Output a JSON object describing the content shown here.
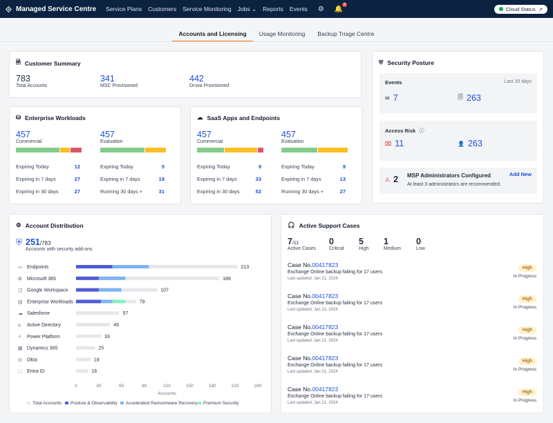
{
  "app": {
    "title": "Managed Service Centre"
  },
  "nav": [
    "Service Plans",
    "Customers",
    "Service Monitoring",
    "Jobs",
    "Reports",
    "Events"
  ],
  "notification_count": "8",
  "cloud_status": "Cloud Status",
  "tabs": [
    "Accounts and Licensing",
    "Usage Monitoring",
    "Backup Triage Centre"
  ],
  "customer_summary": {
    "title": "Customer Summary",
    "total": {
      "value": "783",
      "label": "Total Accounts"
    },
    "msc": {
      "value": "341",
      "label": "MSC Provisioned"
    },
    "druva": {
      "value": "442",
      "label": "Druva Provisioned"
    }
  },
  "security": {
    "title": "Security Posture",
    "events_label": "Events",
    "period": "Last 30 days",
    "events": [
      "7",
      "263"
    ],
    "risk_label": "Access Risk",
    "risk": [
      "11",
      "263"
    ],
    "admins": {
      "count": "2",
      "title": "MSP Administrators Configured",
      "note": "At least 3 administrators are recommended.",
      "action": "Add New"
    }
  },
  "enterprise": {
    "title": "Enterprise Workloads",
    "commercial": {
      "value": "457",
      "label": "Commercial",
      "rows": [
        [
          "Expiring Today",
          "12"
        ],
        [
          "Expiring in 7 days",
          "27"
        ],
        [
          "Expiring in 30 days",
          "27"
        ]
      ]
    },
    "evaluation": {
      "value": "457",
      "label": "Evaluation",
      "rows": [
        [
          "Expiring Today",
          "5"
        ],
        [
          "Expiring in 7 days",
          "19"
        ],
        [
          "Running 30 days +",
          "31"
        ]
      ]
    }
  },
  "saas": {
    "title": "SaaS Apps and Endpoints",
    "commercial": {
      "value": "457",
      "label": "Commercial",
      "rows": [
        [
          "Expiring Today",
          "9"
        ],
        [
          "Expiring in 7 days",
          "33"
        ],
        [
          "Expiring in 30 days",
          "52"
        ]
      ]
    },
    "evaluation": {
      "value": "457",
      "label": "Evaluation",
      "rows": [
        [
          "Expiring Today",
          "9"
        ],
        [
          "Expiring in 7 days",
          "13"
        ],
        [
          "Running 30 days +",
          "27"
        ]
      ]
    }
  },
  "distribution": {
    "title": "Account Distribution",
    "count": "251",
    "total": "/783",
    "subtitle": "Accounts with security add-ons",
    "xlabel": "Accounts",
    "legend": [
      "Total Accounts",
      "Posture & Observability",
      "Accelerated Ransomware Recovery",
      "Premium Security"
    ]
  },
  "chart_data": {
    "type": "bar",
    "orientation": "horizontal",
    "categories": [
      "Endpoints",
      "Microsoft 365",
      "Google Workspace",
      "Enterprise Workloads",
      "Salesforce",
      "Active Directory",
      "Power Platform",
      "Dynamics 365",
      "Okta",
      "Entra ID"
    ],
    "series": [
      {
        "name": "Total Accounts",
        "values": [
          213,
          189,
          107,
          79,
          57,
          45,
          33,
          25,
          19,
          16
        ]
      },
      {
        "name": "Posture & Observability",
        "values": [
          48,
          30,
          30,
          33,
          0,
          0,
          0,
          0,
          0,
          0
        ]
      },
      {
        "name": "Accelerated Ransomware Recovery",
        "values": [
          48,
          35,
          30,
          15,
          0,
          0,
          0,
          0,
          0,
          0
        ]
      },
      {
        "name": "Premium Security",
        "values": [
          0,
          0,
          0,
          17,
          0,
          0,
          0,
          0,
          0,
          0
        ]
      }
    ],
    "xlim": [
      0,
      240
    ],
    "xticks": [
      "0",
      "30",
      "60",
      "90",
      "120",
      "150",
      "180",
      "210",
      "240"
    ],
    "xlabel": "Accounts",
    "legend_position": "bottom",
    "colors": [
      "#e5e7eb",
      "#4f5bd5",
      "#7cb5f0",
      "#86efc0"
    ]
  },
  "support": {
    "title": "Active Support Cases",
    "stats": [
      [
        "7",
        "/11",
        "Active Cases"
      ],
      [
        "0",
        "",
        "Critical"
      ],
      [
        "5",
        "",
        "High"
      ],
      [
        "1",
        "",
        "Medium"
      ],
      [
        "0",
        "",
        "Low"
      ]
    ],
    "cases": [
      {
        "prefix": "Case No.",
        "number": "00417823",
        "desc": "Exchange Online backup failing for 17 users",
        "updated": "Last updated: Jan 21, 2024",
        "priority": "High",
        "status": "In Progress"
      },
      {
        "prefix": "Case No.",
        "number": "00417823",
        "desc": "Exchange Online backup failing for 17 users",
        "updated": "Last updated: Jan 21, 2024",
        "priority": "High",
        "status": "In Progress"
      },
      {
        "prefix": "Case No.",
        "number": "00417823",
        "desc": "Exchange Online backup failing for 17 users",
        "updated": "Last updated: Jan 21, 2024",
        "priority": "High",
        "status": "In Progress"
      },
      {
        "prefix": "Case No.",
        "number": "00417823",
        "desc": "Exchange Online backup failing for 17 users",
        "updated": "Last updated: Jan 21, 2024",
        "priority": "High",
        "status": "In Progress"
      },
      {
        "prefix": "Case No.",
        "number": "00417823",
        "desc": "Exchange Online backup failing for 17 users",
        "updated": "Last updated: Jan 21, 2024",
        "priority": "High",
        "status": "In Progress"
      }
    ]
  }
}
